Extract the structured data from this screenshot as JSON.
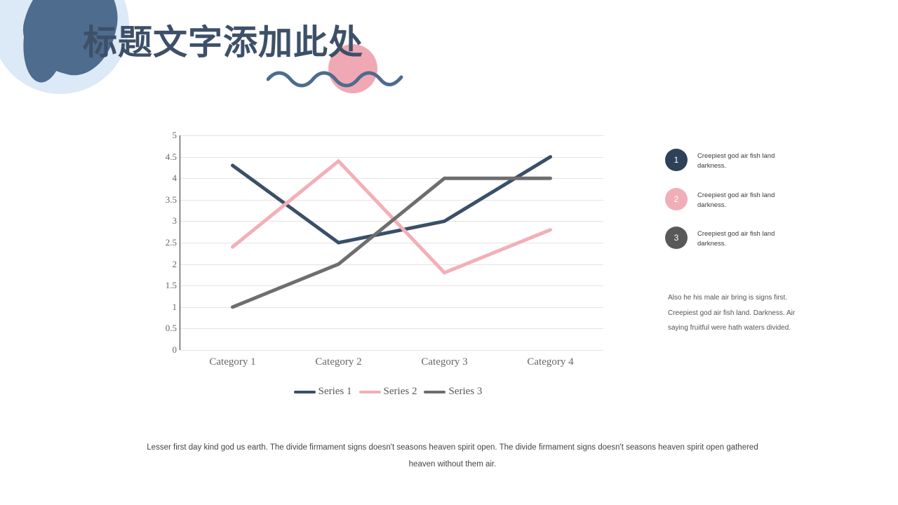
{
  "title": "标题文字添加此处",
  "colors": {
    "navy": "#3C5069",
    "series1": "#3A4F68",
    "series2": "#F2AFB8",
    "series3": "#6E6E6E",
    "badge1": "#2E4159",
    "badge2": "#F0AEB8",
    "badge3": "#595959",
    "light_blue": "#DCE9F6",
    "blob_blue": "#4E6C8D",
    "pink_circle": "#F0A9B4",
    "gridline": "#E3E3E3",
    "axis": "#2C2C2C"
  },
  "chart_data": {
    "type": "line",
    "title": "",
    "xlabel": "",
    "ylabel": "",
    "grid": true,
    "legend_position": "bottom",
    "ylim": [
      0,
      5
    ],
    "categories": [
      "Category 1",
      "Category 2",
      "Category 3",
      "Category 4"
    ],
    "ytick_labels": [
      "5",
      "4.5",
      "4",
      "3.5",
      "3",
      "2.5",
      "2",
      "1.5",
      "1",
      "0.5",
      "0"
    ],
    "yticks": [
      5,
      4.5,
      4,
      3.5,
      3,
      2.5,
      2,
      1.5,
      1,
      0.5,
      0
    ],
    "series": [
      {
        "name": "Series 1",
        "color": "#3A4F68",
        "values": [
          4.3,
          2.5,
          3.0,
          4.5
        ]
      },
      {
        "name": "Series 2",
        "color": "#F2AFB8",
        "values": [
          2.4,
          4.4,
          1.8,
          2.8
        ]
      },
      {
        "name": "Series 3",
        "color": "#6E6E6E",
        "values": [
          1.0,
          2.0,
          4.0,
          4.0
        ]
      }
    ]
  },
  "bullets": [
    {
      "number": "1",
      "text": "Creepiest god air fish land darkness.",
      "color": "#2E4159"
    },
    {
      "number": "2",
      "text": "Creepiest god air fish land darkness.",
      "color": "#F0AEB8"
    },
    {
      "number": "3",
      "text": "Creepiest god air fish land darkness.",
      "color": "#595959"
    }
  ],
  "side_paragraph": "Also he his male air bring is signs first. Creepiest god air fish land. Darkness. Air saying fruitful were hath waters divided.",
  "bottom_paragraph": "Lesser first day kind god us earth. The divide firmament signs doesn't seasons heaven spirit open. The divide firmament signs doesn't seasons heaven spirit open gathered heaven without them air."
}
